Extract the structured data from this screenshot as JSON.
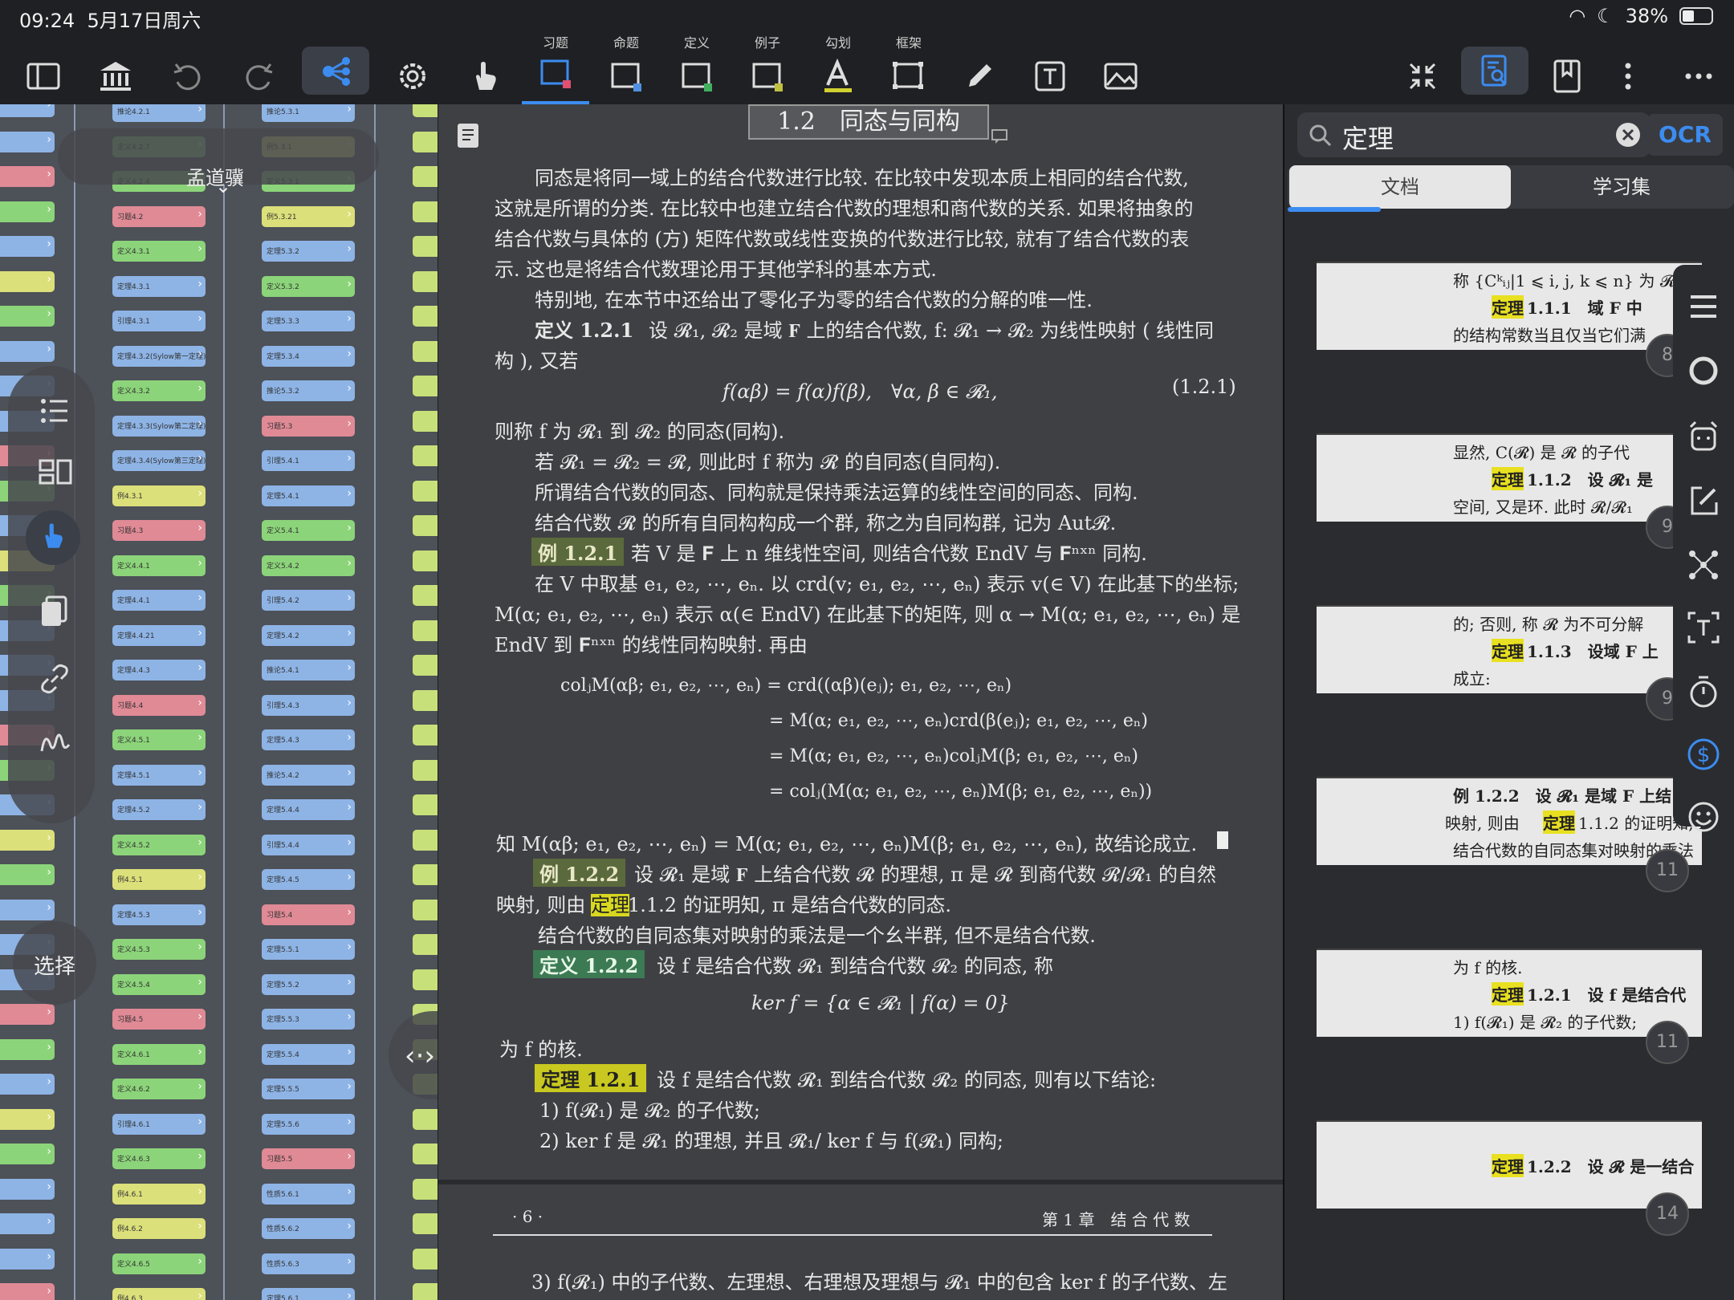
{
  "status": {
    "time": "09:24",
    "date": "5月17日周六",
    "battery": "38%"
  },
  "toolbar": {
    "labels": {
      "exercise": "习题",
      "proposition": "命题",
      "definition": "定义",
      "example": "例子",
      "underline": "勾划",
      "frame": "框架"
    }
  },
  "mindmap": {
    "floating_title": "孟道骥",
    "select_label": "选择",
    "col1": [
      "推论4.2.1",
      "定义4.2.7",
      "定义4.2.4",
      "习题4.2",
      "定义4.3.1",
      "定理4.3.1",
      "引理4.3.1",
      "定理4.3.2(Sylow第一定理)",
      "定义4.3.2",
      "定理4.3.3(Sylow第二定理)",
      "定理4.3.4(Sylow第三定理)",
      "例4.3.1",
      "习题4.3",
      "定义4.4.1",
      "定理4.4.1",
      "定理4.4.21",
      "定理4.4.3",
      "习题4.4",
      "定义4.5.1",
      "定理4.5.1",
      "定理4.5.2",
      "定义4.5.2",
      "例4.5.1",
      "定理4.5.3",
      "定义4.5.3",
      "定义4.5.4",
      "习题4.5",
      "定义4.6.1",
      "定义4.6.2",
      "引理4.6.1",
      "定义4.6.3",
      "例4.6.1",
      "例4.6.2",
      "定义4.6.5",
      "例4.6.3"
    ],
    "col2": [
      "推论5.3.1",
      "例5.3.1",
      "定义5.3.1",
      "例5.3.21",
      "定理5.3.2",
      "定义5.3.2",
      "定理5.3.3",
      "定理5.3.4",
      "推论5.3.2",
      "习题5.3",
      "引理5.4.1",
      "定理5.4.1",
      "定义5.4.1",
      "定义5.4.2",
      "引理5.4.2",
      "定理5.4.2",
      "推论5.4.1",
      "引理5.4.3",
      "定理5.4.3",
      "推论5.4.2",
      "定理5.4.4",
      "引理5.4.4",
      "定理5.4.5",
      "习题5.4",
      "定理5.5.1",
      "定理5.5.2",
      "定理5.5.3",
      "定理5.5.4",
      "定理5.5.5",
      "定理5.5.6",
      "习题5.5",
      "性质5.6.1",
      "性质5.6.2",
      "性质5.6.3",
      "定理5.6.1"
    ]
  },
  "document": {
    "section_title": "1.2　同态与同构",
    "lines": [
      "同态是将同一域上的结合代数进行比较. 在比较中发现本质上相同的结合代数,",
      "这就是所谓的分类. 在比较中也建立结合代数的理想和商代数的关系. 如果将抽象的",
      "结合代数与具体的 (方) 矩阵代数或线性变换的代数进行比较, 就有了结合代数的表",
      "示. 这也是将结合代数理论用于其他学科的基本方式.",
      "特别地, 在本节中还给出了零化子为零的结合代数的分解的唯一性.",
      "设 𝓡₁, 𝓡₂ 是域 𝐅 上的结合代数, f: 𝓡₁ → 𝓡₂ 为线性映射 ( 线性同",
      "构 ), 又若",
      "f(αβ) = f(α)f(β),　∀α, β ∈ 𝓡₁,",
      "(1.2.1)",
      "则称 f 为 𝓡₁ 到 𝓡₂ 的同态(同构).",
      "若 𝓡₁ = 𝓡₂ = 𝓡, 则此时 f 称为 𝓡 的自同态(自同构).",
      "所谓结合代数的同态、同构就是保持乘法运算的线性空间的同态、同构.",
      "结合代数 𝓡 的所有自同构构成一个群, 称之为自同构群, 记为 Aut𝓡.",
      "若 V 是 𝐅 上 n 维线性空间, 则结合代数 EndV 与 𝐅ⁿˣⁿ 同构.",
      "在 V 中取基 e₁, e₂, ⋯, eₙ. 以 crd(v; e₁, e₂, ⋯, eₙ) 表示 v(∈ V) 在此基下的坐标;",
      "M(α; e₁, e₂, ⋯, eₙ) 表示 α(∈ EndV) 在此基下的矩阵, 则 α → M(α; e₁, e₂, ⋯, eₙ) 是",
      "EndV 到 𝐅ⁿˣⁿ 的线性同构映射. 再由",
      "colⱼM(αβ; e₁, e₂, ⋯, eₙ) = crd((αβ)(eⱼ); e₁, e₂, ⋯, eₙ)",
      "= M(α; e₁, e₂, ⋯, eₙ)crd(β(eⱼ); e₁, e₂, ⋯, eₙ)",
      "= M(α; e₁, e₂, ⋯, eₙ)colⱼM(β; e₁, e₂, ⋯, eₙ)",
      "= colⱼ(M(α; e₁, e₂, ⋯, eₙ)M(β; e₁, e₂, ⋯, eₙ))",
      "知 M(αβ; e₁, e₂, ⋯, eₙ) = M(α; e₁, e₂, ⋯, eₙ)M(β; e₁, e₂, ⋯, eₙ), 故结论成立.",
      "设 𝓡₁ 是域 𝐅 上结合代数 𝓡 的理想, π 是 𝓡 到商代数 𝓡/𝓡₁ 的自然",
      "映射, 则由",
      " 1.1.2 的证明知, π 是结合代数的同态.",
      "结合代数的自同态集对映射的乘法是一个幺半群, 但不是结合代数.",
      "设 f 是结合代数 𝓡₁ 到结合代数 𝓡₂ 的同态, 称",
      "ker f = {α ∈ 𝓡₁ | f(α) = 0}",
      "为 f 的核.",
      "设 f 是结合代数 𝓡₁ 到结合代数 𝓡₂ 的同态, 则有以下结论:",
      "1) f(𝓡₁) 是 𝓡₂ 的子代数;",
      "2) ker f 是 𝓡₁ 的理想, 并且 𝓡₁/ ker f 与 f(𝓡₁) 同构;",
      "3) f(𝓡₁) 中的子代数、左理想、右理想及理想与 𝓡₁ 中的包含 ker f 的子代数、左"
    ],
    "tags": {
      "def121": "定义 1.2.1",
      "ex121": "例 1.2.1",
      "ex122": "例 1.2.2",
      "def122": "定义 1.2.2",
      "thm121": "定理 1.2.1",
      "theorem_word": "定理"
    },
    "footer_page": "· 6 ·",
    "footer_chapter": "第 1 章　结 合 代 数"
  },
  "sidebar": {
    "search_value": "定理",
    "ocr_label": "OCR",
    "tabs": [
      "文档",
      "学习集"
    ],
    "results": [
      {
        "l1": "称 {Cᵏᵢⱼ|1 ⩽ i, j, k ⩽ n} 为 𝓡",
        "hl": "定理",
        "l2": " 1.1.1　域 𝐅 中",
        "l3": "的结构常数当且仅当它们满",
        "page": "8"
      },
      {
        "l1": "显然, C(𝓡) 是 𝓡 的子代",
        "hl": "定理",
        "l2": " 1.1.2　设 𝓡₁ 是",
        "l3": "空间, 又是环. 此时 𝓡/𝓡₁",
        "page": "9"
      },
      {
        "l1": "的; 否则, 称 𝓡 为不可分解",
        "hl": "定理",
        "l2": " 1.1.3　设域 𝐅 上",
        "l3": "成立:",
        "page": "9"
      },
      {
        "l1": "例 1.2.2　设 𝓡₁ 是域 𝐅 上结",
        "hl": "定理",
        "l2": " 1.1.2 的证明知, π",
        "l3": "结合代数的自同态集对映射的乘法",
        "page": "11",
        "prefix": "映射, 则由"
      },
      {
        "l1": "为 f 的核.",
        "hl": "定理",
        "l2": " 1.2.1　设 f 是结合代",
        "l3": "1) f(𝓡₁) 是 𝓡₂ 的子代数;",
        "page": "11"
      },
      {
        "l1": "",
        "hl": "定理",
        "l2": " 1.2.2　设 𝓡 是一结合",
        "l3": "",
        "page": "14"
      }
    ]
  }
}
